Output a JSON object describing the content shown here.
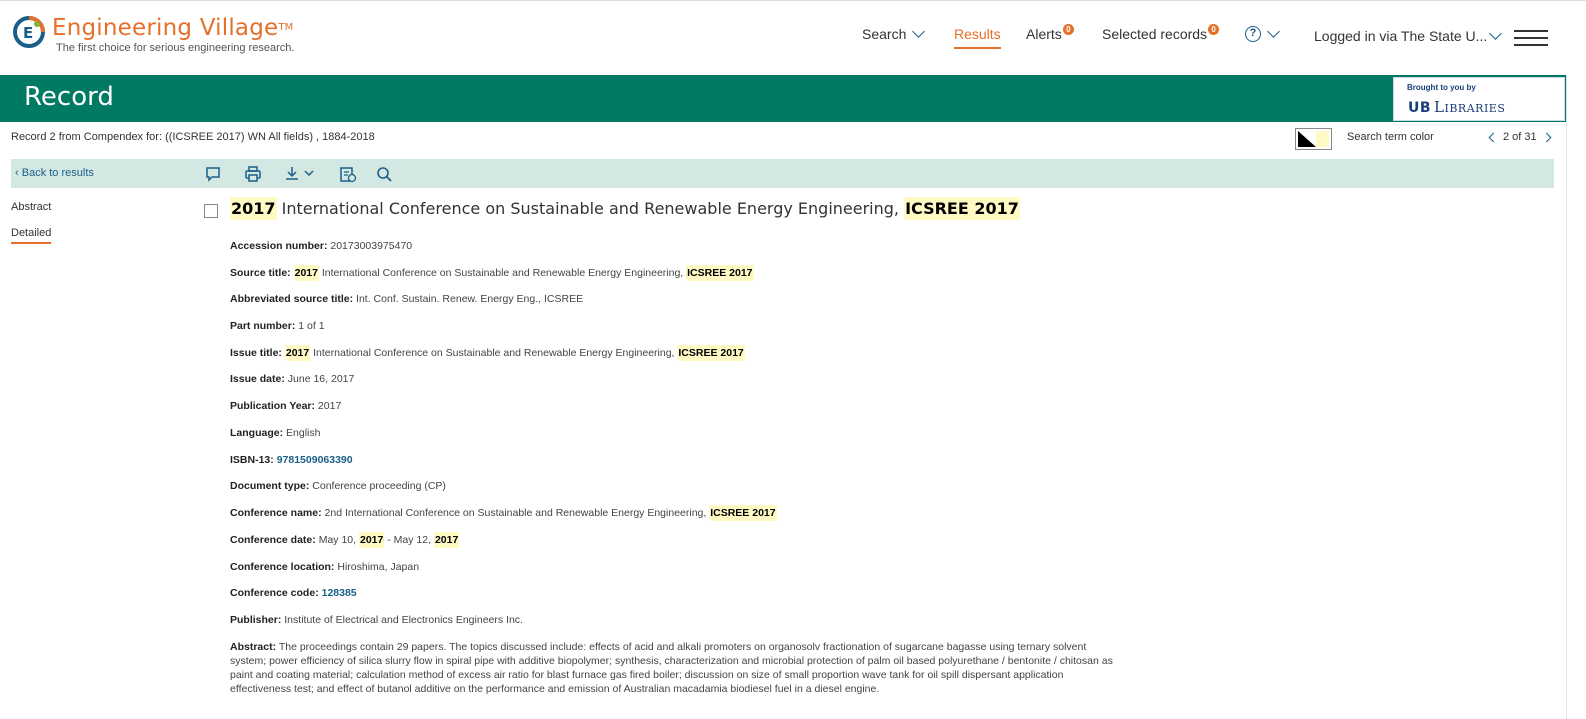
{
  "brand": {
    "title": "Engineering Village",
    "tm": "TM",
    "tagline": "The first choice for serious engineering research.",
    "accent_color": "#e5702a",
    "logo_icon": "ev-logo-icon"
  },
  "nav": {
    "search": "Search",
    "results": "Results",
    "alerts": "Alerts",
    "alerts_badge": "0",
    "selected": "Selected records",
    "selected_badge": "0",
    "help_glyph": "?",
    "logged_in": "Logged in via The State U..."
  },
  "band": {
    "title": "Record",
    "color": "#007a63",
    "brought_by": "Brought to you by",
    "library_mark": "UB",
    "library_name": "Libraries"
  },
  "record_bar": {
    "record_line": "Record 2 from Compendex for: ((ICSREE 2017) WN All fields) , 1884-2018",
    "search_term_color": "Search term color",
    "pager": "2 of 31"
  },
  "toolbar": {
    "back": "Back to results"
  },
  "side_nav": {
    "abstract": "Abstract",
    "detailed": "Detailed"
  },
  "record": {
    "title_hl1": "2017",
    "title_mid": " International Conference on Sustainable and Renewable Energy Engineering, ",
    "title_hl2": "ICSREE 2017",
    "fields": {
      "accession_label": "Accession number:",
      "accession_value": "20173003975470",
      "source_label": "Source title:",
      "source_hl1": "2017",
      "source_mid": " International Conference on Sustainable and Renewable Energy Engineering, ",
      "source_hl2": "ICSREE 2017",
      "abbrev_label": "Abbreviated source title:",
      "abbrev_value": "Int. Conf. Sustain. Renew. Energy Eng., ICSREE",
      "part_label": "Part number:",
      "part_value": "1 of 1",
      "issue_label": "Issue title:",
      "issue_hl1": "2017",
      "issue_mid": " International Conference on Sustainable and Renewable Energy Engineering, ",
      "issue_hl2": "ICSREE 2017",
      "issue_date_label": "Issue date:",
      "issue_date_value": "June 16, 2017",
      "pub_year_label": "Publication Year:",
      "pub_year_value": "2017",
      "language_label": "Language:",
      "language_value": "English",
      "isbn_label": "ISBN-13:",
      "isbn_value": "9781509063390",
      "doctype_label": "Document type:",
      "doctype_value": "Conference proceeding (CP)",
      "confname_label": "Conference name:",
      "confname_mid": "2nd International Conference on Sustainable and Renewable Energy Engineering, ",
      "confname_hl": "ICSREE 2017",
      "confdate_label": "Conference date:",
      "confdate_p1": "May 10, ",
      "confdate_hl1": "2017",
      "confdate_p2": " - May 12, ",
      "confdate_hl2": "2017",
      "conflocation_label": "Conference location:",
      "conflocation_value": "Hiroshima, Japan",
      "confcode_label": "Conference code:",
      "confcode_value": "128385",
      "publisher_label": "Publisher:",
      "publisher_value": "Institute of Electrical and Electronics Engineers Inc.",
      "abstract_label": "Abstract:",
      "abstract_value": "The proceedings contain 29 papers. The topics discussed include: effects of acid and alkali promoters on organosolv fractionation of sugarcane bagasse using ternary solvent system; power efficiency of silica slurry flow in spiral pipe with additive biopolymer; synthesis, characterization and microbial protection of palm oil based polyurethane / bentonite / chitosan as paint and coating material; calculation method of excess air ratio for blast furnace gas fired boiler; discussion on size of small proportion wave tank for oil spill dispersant application effectiveness test; and effect of butanol additive on the performance and emission of Australian macadamia biodiesel fuel in a diesel engine."
    }
  }
}
